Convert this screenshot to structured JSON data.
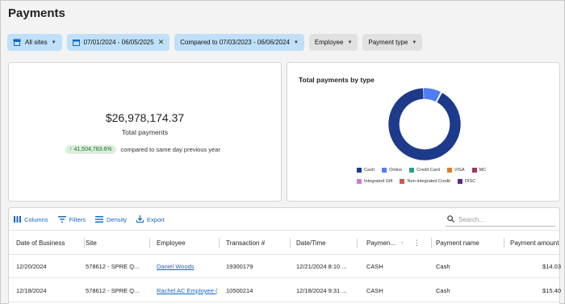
{
  "page": {
    "title": "Payments"
  },
  "filters": {
    "sites": "All sites",
    "date_range": "07/01/2024 - 06/05/2025",
    "compared": "Compared to 07/03/2023 - 06/06/2024",
    "employee": "Employee",
    "payment_type": "Payment type"
  },
  "summary": {
    "amount": "$26,978,174.37",
    "label": "Total payments",
    "change": "↑ 41,504,783.6%",
    "compare_text": "compared to same day previous year"
  },
  "chart": {
    "title": "Total payments by type",
    "legend": [
      "Cash",
      "Online",
      "Credit Card",
      "VISA",
      "MC",
      "Integrated Gift",
      "Non-integrated Credit",
      "DISC"
    ],
    "colors": [
      "#1e3a8a",
      "#4f7cf7",
      "#2a9d8f",
      "#e07b24",
      "#a83263",
      "#d17ad8",
      "#d9534f",
      "#5b2a86"
    ]
  },
  "chart_data": {
    "type": "pie",
    "title": "Total payments by type",
    "categories": [
      "Cash",
      "Online",
      "Credit Card",
      "VISA",
      "MC",
      "Integrated Gift",
      "Non-integrated Credit",
      "DISC"
    ],
    "values": [
      91.5,
      8.0,
      0.1,
      0.1,
      0.1,
      0.1,
      0.05,
      0.05
    ]
  },
  "toolbar": {
    "columns": "Columns",
    "filters": "Filters",
    "density": "Density",
    "export": "Export",
    "search_placeholder": "Search..."
  },
  "table": {
    "headers": [
      "Date of Business",
      "Site",
      "Employee",
      "Transaction #",
      "Date/Time",
      "Paymen...",
      "Payment name",
      "Payment amount"
    ],
    "rows": [
      [
        "12/20/2024",
        "578612 - SPRE Q...",
        "Daniel Woods",
        "19300179",
        "12/21/2024 8:10 ...",
        "CASH",
        "Cash",
        "$14.03"
      ],
      [
        "12/18/2024",
        "578612 - SPRE Q...",
        "Rachel AC Employee (",
        "10500214",
        "12/18/2024 9:31 ...",
        "CASH",
        "Cash",
        "$15.40"
      ]
    ]
  }
}
